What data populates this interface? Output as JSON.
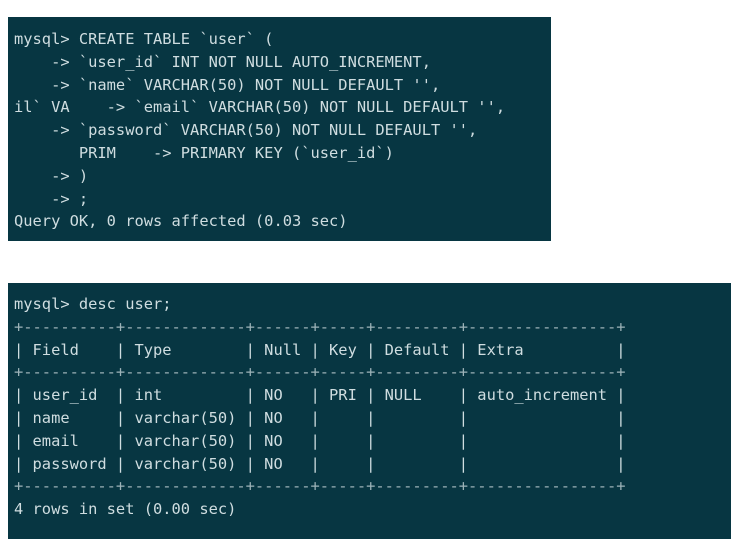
{
  "terminal1": {
    "lines": [
      "mysql> CREATE TABLE `user` (",
      "    -> `user_id` INT NOT NULL AUTO_INCREMENT,",
      "    -> `name` VARCHAR(50) NOT NULL DEFAULT '',",
      "il` VA    -> `email` VARCHAR(50) NOT NULL DEFAULT '',",
      "    -> `password` VARCHAR(50) NOT NULL DEFAULT '',",
      "       PRIM    -> PRIMARY KEY (`user_id`)",
      "    -> )",
      "    -> ;",
      "Query OK, 0 rows affected (0.03 sec)"
    ]
  },
  "terminal2": {
    "prompt": "mysql> desc user;",
    "border": "+----------+-------------+------+-----+---------+----------------+",
    "header": "| Field    | Type        | Null | Key | Default | Extra          |",
    "rows": [
      "| user_id  | int         | NO   | PRI | NULL    | auto_increment |",
      "| name     | varchar(50) | NO   |     |         |                |",
      "| email    | varchar(50) | NO   |     |         |                |",
      "| password | varchar(50) | NO   |     |         |                |"
    ],
    "footer": "4 rows in set (0.00 sec)"
  },
  "colors": {
    "terminal_bg": "#073642",
    "terminal_fg": "#cfdde0"
  }
}
